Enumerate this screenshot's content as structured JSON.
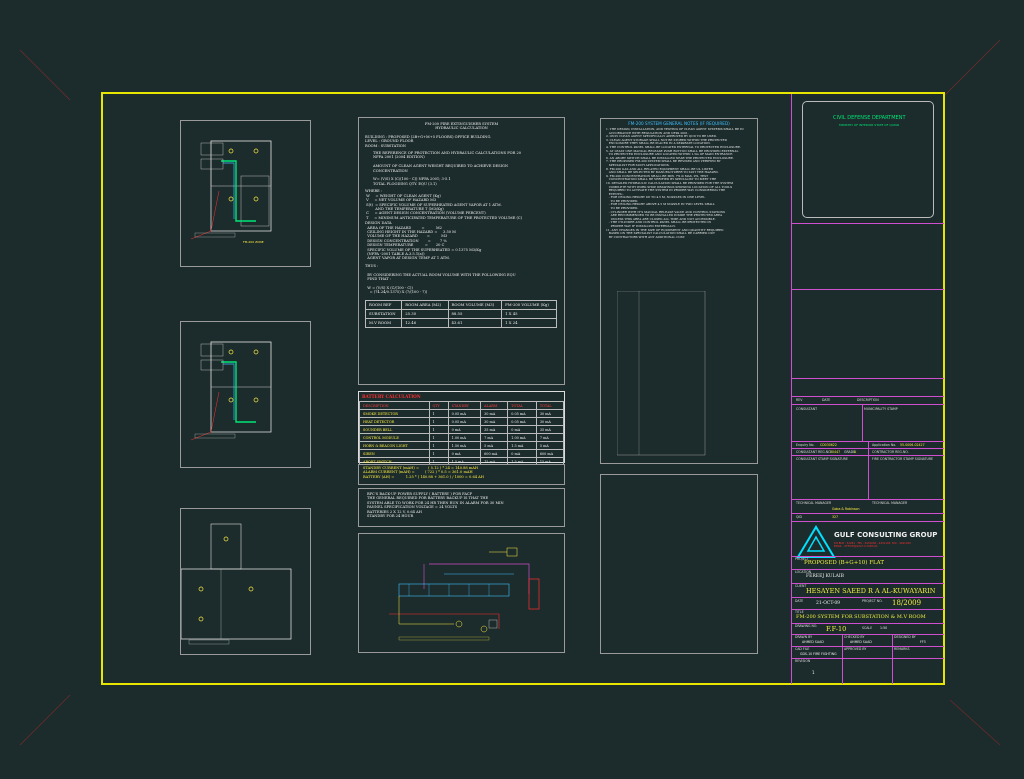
{
  "calc": {
    "header": [
      "FM-200 FIRE EXTINGUISHER SYSTEM",
      "HYDRAULIC CALCULATION"
    ],
    "intro": "BUILDING : PROPOSED (2B+G+M+5 FLOORS) OFFICE BUILDING.\nLEVEL : GROUND FLOOR\nROOM : SUBSTATION",
    "body1": "THE REFERENCE OF PROTECTION AND HYDRAULIC CALCULATIONS FOR 20\nNFPA 2001 (2004 EDITION)\n\nAMOUNT OF CLEAN AGENT WEIGHT REQUIRED TO ACHIEVE DESIGN\nCONCENTRATION\n\nW= (V/S) X (C/(100 - C)) NFPA 2001; 3-5.1\nTOTAL FLOODING QTY. EQU (3.1)",
    "where": "WHERE :\n W     = WEIGHT OF CLEAN AGENT (Kg)\n V     = NET VOLUME OF HAZARD M3\n S(t)  = SPECIFIC VOLUME OF SUPERHEATED AGENT VAPOR AT 1 ATM.\n         AND THE TEMPERATURE T (M3/Kg)\n C     = AGENT DESIGN CONCENTRATION (VOLUME PERCENT)\n T     = MINIMUM ANTICIPATED TEMPERATURE OF THE PROTECTED VOLUME (C)",
    "design": "DESIGN DATA\n  AREA OF THE HAZARD         =          M2\n  CEILING HEIGHT IN THE HAZARD =     3.50 M\n  VOLUME OF THE HAZARD        =          M3\n  DESIGN CONCENTRATION        =        7 %\n  DESIGN TEMPERATURE          =       20 C\n  SPECIFIC VOLUME OF THE SUPERHEATED = 0.1375 M3/Kg\n  (NFPA -2001 TABLE A.3.5.1(a))\n  AGENT VAPOR AT DESIGN TEMP AT 1 ATM.",
    "thus": "THUS :\n\n  BY CONSIDERING THE ACTUAL ROOM VOLUME WITH THE FOLLOWING EQU\n  FIND THAT :\n\n  W = (V/S) X (C/(100 - C))\n    = (74.24/0.1375) X (7/(100 - 7))",
    "table_head": [
      "ROOM REF",
      "ROOM AREA (M2)",
      "ROOM VOLUME (M3)",
      "FM-200 VOLUME (Kg)"
    ],
    "table_rows": [
      [
        "SUBSTATION",
        "25.30",
        "88.55",
        "1 X 45"
      ],
      [
        "M.V ROOM",
        "12.46",
        "43.61",
        "1 X 24"
      ]
    ]
  },
  "battery": {
    "title": "BATTERY CALCULATION",
    "cols": [
      "DESCRIPTION",
      "QTY",
      "STANDBY",
      "ALARM",
      "TOTAL",
      "TOTAL"
    ],
    "rows": [
      [
        "SMOKE DETECTOR",
        "1",
        "0.05 mA",
        "30 mA",
        "0.05 mA",
        "30 mA"
      ],
      [
        "HEAT DETECTOR",
        "1",
        "0.05 mA",
        "30 mA",
        "0.05 mA",
        "30 mA"
      ],
      [
        "SOUNDER BELL",
        "1",
        "0 mA",
        "35 mA",
        "0 mA",
        "35 mA"
      ],
      [
        "CONTROL MODULE",
        "1",
        "1.00 mA",
        "7 mA",
        "1.00 mA",
        "7 mA"
      ],
      [
        "HORN & BEACON LIGHT",
        "1",
        "1.50 mA",
        "5 mA",
        "1.5 mA",
        "5 mA"
      ],
      [
        "SIREN",
        "1",
        "0 mA",
        "600 mA",
        "0 mA",
        "600 mA"
      ],
      [
        "ABORT SWITCH",
        "1",
        "1.5 mA",
        "15 mA",
        "1.5 mA",
        "15 mA"
      ]
    ],
    "totals_label": "TOTAL CURRENT",
    "totals": [
      "5.12 mA",
      "722 mA"
    ],
    "summary": "STANDBY CURRENT (mAH) =        ( 5.12 ) * 24 = 140.88 mAH\nALARM CURRENT (mAH) =         ( 722 ) * 0.5 = 361.0 mAH\nBATTERY (AH) =          1.25 * ( 140.88 + 361.0 ) / 1000 = 0.64 AH",
    "backup": "BPC'S BACK-UP POWER SUPPLY ( BATTERY ) FOR FACP\nTHE GENERAL REQUIRED FOR BATTERY BACKUP IS THAT THE\nSYSTEM ABLE TO WORK FOR 24 HR THEN RUN IN ALARM FOR 30 MIN\nPANNEL SPECIFICATION VOLTAGE = 24 VOLTS\nBATTERIES 2 X 12 V, 0.64 AH\nSTANDBY FOR 24 HOUR"
  },
  "notes": {
    "title": "FM-200 SYSTEM GENERAL NOTES (IF REQUIRED)",
    "text": "1. THE DESIGN, INSTALLATION, AND TESTING OF CLEAN AGENT SYSTEMS SHALL BE IN\n   ACCORDANCE WITH REGULATION AND NFPA 2001.\n2. ONLY CLEAN AGENT SPECIFICALLY APPROVED BY QCD TO BE USED.\n3. CLEAN AGENT STORAGE SHALL NOT BE STORED WITHIN THE PROTECTED\n   ENCLOSURE THEY SHALL BE PLACED IN A SEPARATE LOCATION.\n4. THE CONTROL PANEL SHALL BE LOCATED EXTERNAL TO PROTECTED ENCLOSURE.\n5. AT LEAST ONE MANUAL RELEASE PUSH BUTTON SHALL BE PROVIDED EXTERNAL\n   TO PROTECTED ENCLOSURE AND LOCATED WITHIN 1.5m OF MAIN ENTRANCE.\n6. AN ABORT SWITCH SHALL BE INSTALLED NEAR THE PROTECTED ENCLOSURE.\n7. THE PROPOSED FM-200 SYSTEM SHALL BE REVISED AND VERIFIED BY\n   SPECIALIST FOR SUCH APPLICATIONS.\n8. FM-200 GAS AND ALL RELATED EQUIPMENT SHALL BE UL LISTED\n   AND SHALL BE SELECTED BY MANUFACTURER TO SUIT THE HAZARD.\n9. FM-200 CONCENTRATION SHALL BE MIN. 7% & MAX. 9%, TEST\n   CONCENTRATION SHALL BE VERIFIED BY SPECIALIST TO MEET THE\n10. DETAILED HYDRAULIC CALCULATION SHALL BE PROVIDED FOR THE SYSTEM\n   COMPLETE WITH WORK SHOP DRAWINGS SHOWING LOCATION OF ALL TOOLS\n   REQUIRED TO ACTIVATE THE SYSTEM IN PROPER WAY CONSIDERING THE\n   EVENTS:-\n   - FOR CEILING HEIGHT UP TO 4.5 M, NOZZLES IN ONE LEVEL\n     TO BE PROVIDED.\n   - FOR CEILING HEIGHT ABOVE 4.5 M NOZZLE IN TWO LEVEL SHALL\n     TO BE PROVIDED.\n   - CYLINDER WITH IT'S MANUAL RELEASE VALVE AND CONTROL STATIONS\n     ARE RECOMMENDED TO BE INSTALLED INSIDE THE PROTECTED AREA\n     UNLESS THIS AREA ARE CLOSED ALL TIME AND NOT ACCESSIBLE.\n   - THE CYLINDER AND CONTROL PANEL SHALL BE PROTECTED IN\n     PROPER WAY IF INSTALLED EXTERNALLY.\n11. ANY CHANGES IN THE SIZE OF EQUIPMENT AND QUANTITY REQUIRED\n   BASED ON THE SPECIALIST CALCULATION SHALL BE CARRIED OUT\n   BY CONTRACTORS WITH ANY ADDITIONAL COST."
  },
  "plans": {
    "fm200_zone": "FM-200 ZONE",
    "labels": "1 NO'S FM-200\nCYLINDER 45KG\nLOCATED AT\nSUBSTATION"
  },
  "titleblock": {
    "authority": "CIVIL DEFENSE DEPARTMENT",
    "ministry": "MINISTRY OF INTERIOR STATE OF QATAR",
    "rev_cols": [
      "REV",
      "DATE",
      "DESCRIPTION"
    ],
    "consultant": "CONSULTANT",
    "municipality": "MUNICIPALITY STAMP",
    "enquiry_label": "Enquiry No.",
    "enquiry_no": "CD030622",
    "application_label": "Application No.",
    "application_no": "55-0006-02427",
    "consultant_reg": "CONSULTANT REG.NO.",
    "consultant_reg_val": "30447",
    "grade": "GRADE",
    "grade_val": "A",
    "contractor_reg": "CONTRACTOR REG.NO.",
    "contractor_stamp": "CONSULTANT STAMP SIGNATURE",
    "contractor_stamp2": "FIRE CONTRACTOR STAMP SIGNATURE",
    "tech_manager": "TECHNICAL MANAGER",
    "tech_manager_val": "Goba & Robinson",
    "tech_manager2": "TECHNICAL MANAGER",
    "qid_label": "QID",
    "qid_val": "327",
    "company": "GULF CONSULTING GROUP",
    "company_sub": "P.O.BOX : 32261 · TEL : 4431030 - 4431103, FAX : 4441010\nEMAIL : OFFICE@GULF-C.COM.QA",
    "project_label": "PROJECT",
    "project": "PROPOSED (B+G+10) FLAT",
    "location_label": "LOCATION",
    "location": "FEREEJ KULAIB",
    "client_label": "CLIENT",
    "client": "HESAYEN SAEED R A AL-KUWAYARIN",
    "date_label": "DATE",
    "date": "21-OCT-09",
    "project_no_label": "PROJECT NO.",
    "project_no": "18/2009",
    "title_label": "TITLE",
    "title": "FM-200 SYSTEM FOR SUBSTATION & M.V ROOM",
    "drawing_no_label": "DRAWING NO.",
    "drawing_no": "F.F-10",
    "scale_label": "SCALE",
    "scale": "1:50",
    "drawn_label": "DRAWN BY",
    "drawn": "AHMED SAAD",
    "checked_label": "CHECKED BY",
    "checked": "AHMED SAAD",
    "designed_label": "DESIGNED BY",
    "designed": "FF3",
    "cad_file_label": "CAD FILE",
    "cad_file": "GDS-10 FIRE FIGHTING",
    "approved_label": "APPROVED BY",
    "remarks_label": "REMARKS",
    "revision_label": "REVISION",
    "revision": "1"
  },
  "colors": {
    "background": "#1c2b2b",
    "frame": "#e6e600",
    "titleblock": "#d04fd0",
    "authority": "#00e676",
    "accent_yellow": "#f0f040",
    "red": "#ff3030"
  }
}
